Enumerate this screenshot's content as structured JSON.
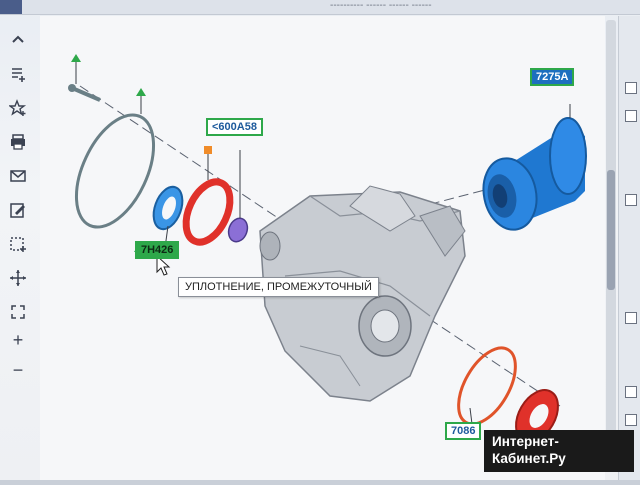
{
  "window": {
    "title": "---------- ------ ------ ------"
  },
  "toolbar": {
    "items": [
      {
        "name": "collapse-up",
        "icon": "chevron-up-icon"
      },
      {
        "name": "add-note",
        "icon": "note-add-icon"
      },
      {
        "name": "favorite",
        "icon": "star-add-icon"
      },
      {
        "name": "print",
        "icon": "printer-icon"
      },
      {
        "name": "email",
        "icon": "envelope-icon"
      },
      {
        "name": "edit",
        "icon": "edit-icon"
      },
      {
        "name": "select-area",
        "icon": "select-area-icon"
      },
      {
        "name": "pan",
        "icon": "move-icon"
      },
      {
        "name": "fit",
        "icon": "fit-icon"
      },
      {
        "name": "zoom-in",
        "icon": "plus-icon",
        "glyph": "+"
      },
      {
        "name": "zoom-out",
        "icon": "minus-icon",
        "glyph": "−"
      }
    ]
  },
  "diagram": {
    "callouts": {
      "part_7h426": "7H426",
      "part_600a58": "<600A58",
      "part_7275a": "7275A",
      "part_7086": "7086"
    },
    "tooltip": "УПЛОТНЕНИЕ, ПРОМЕЖУТОЧНЫЙ"
  },
  "watermark": {
    "line1": "Интернет-",
    "line2": "Кабинет.Ру"
  },
  "colors": {
    "seal_red": "#e0312a",
    "part_blue": "#1f78d1",
    "oring_grey": "#6a7f86",
    "callout_green": "#2ea84a"
  }
}
